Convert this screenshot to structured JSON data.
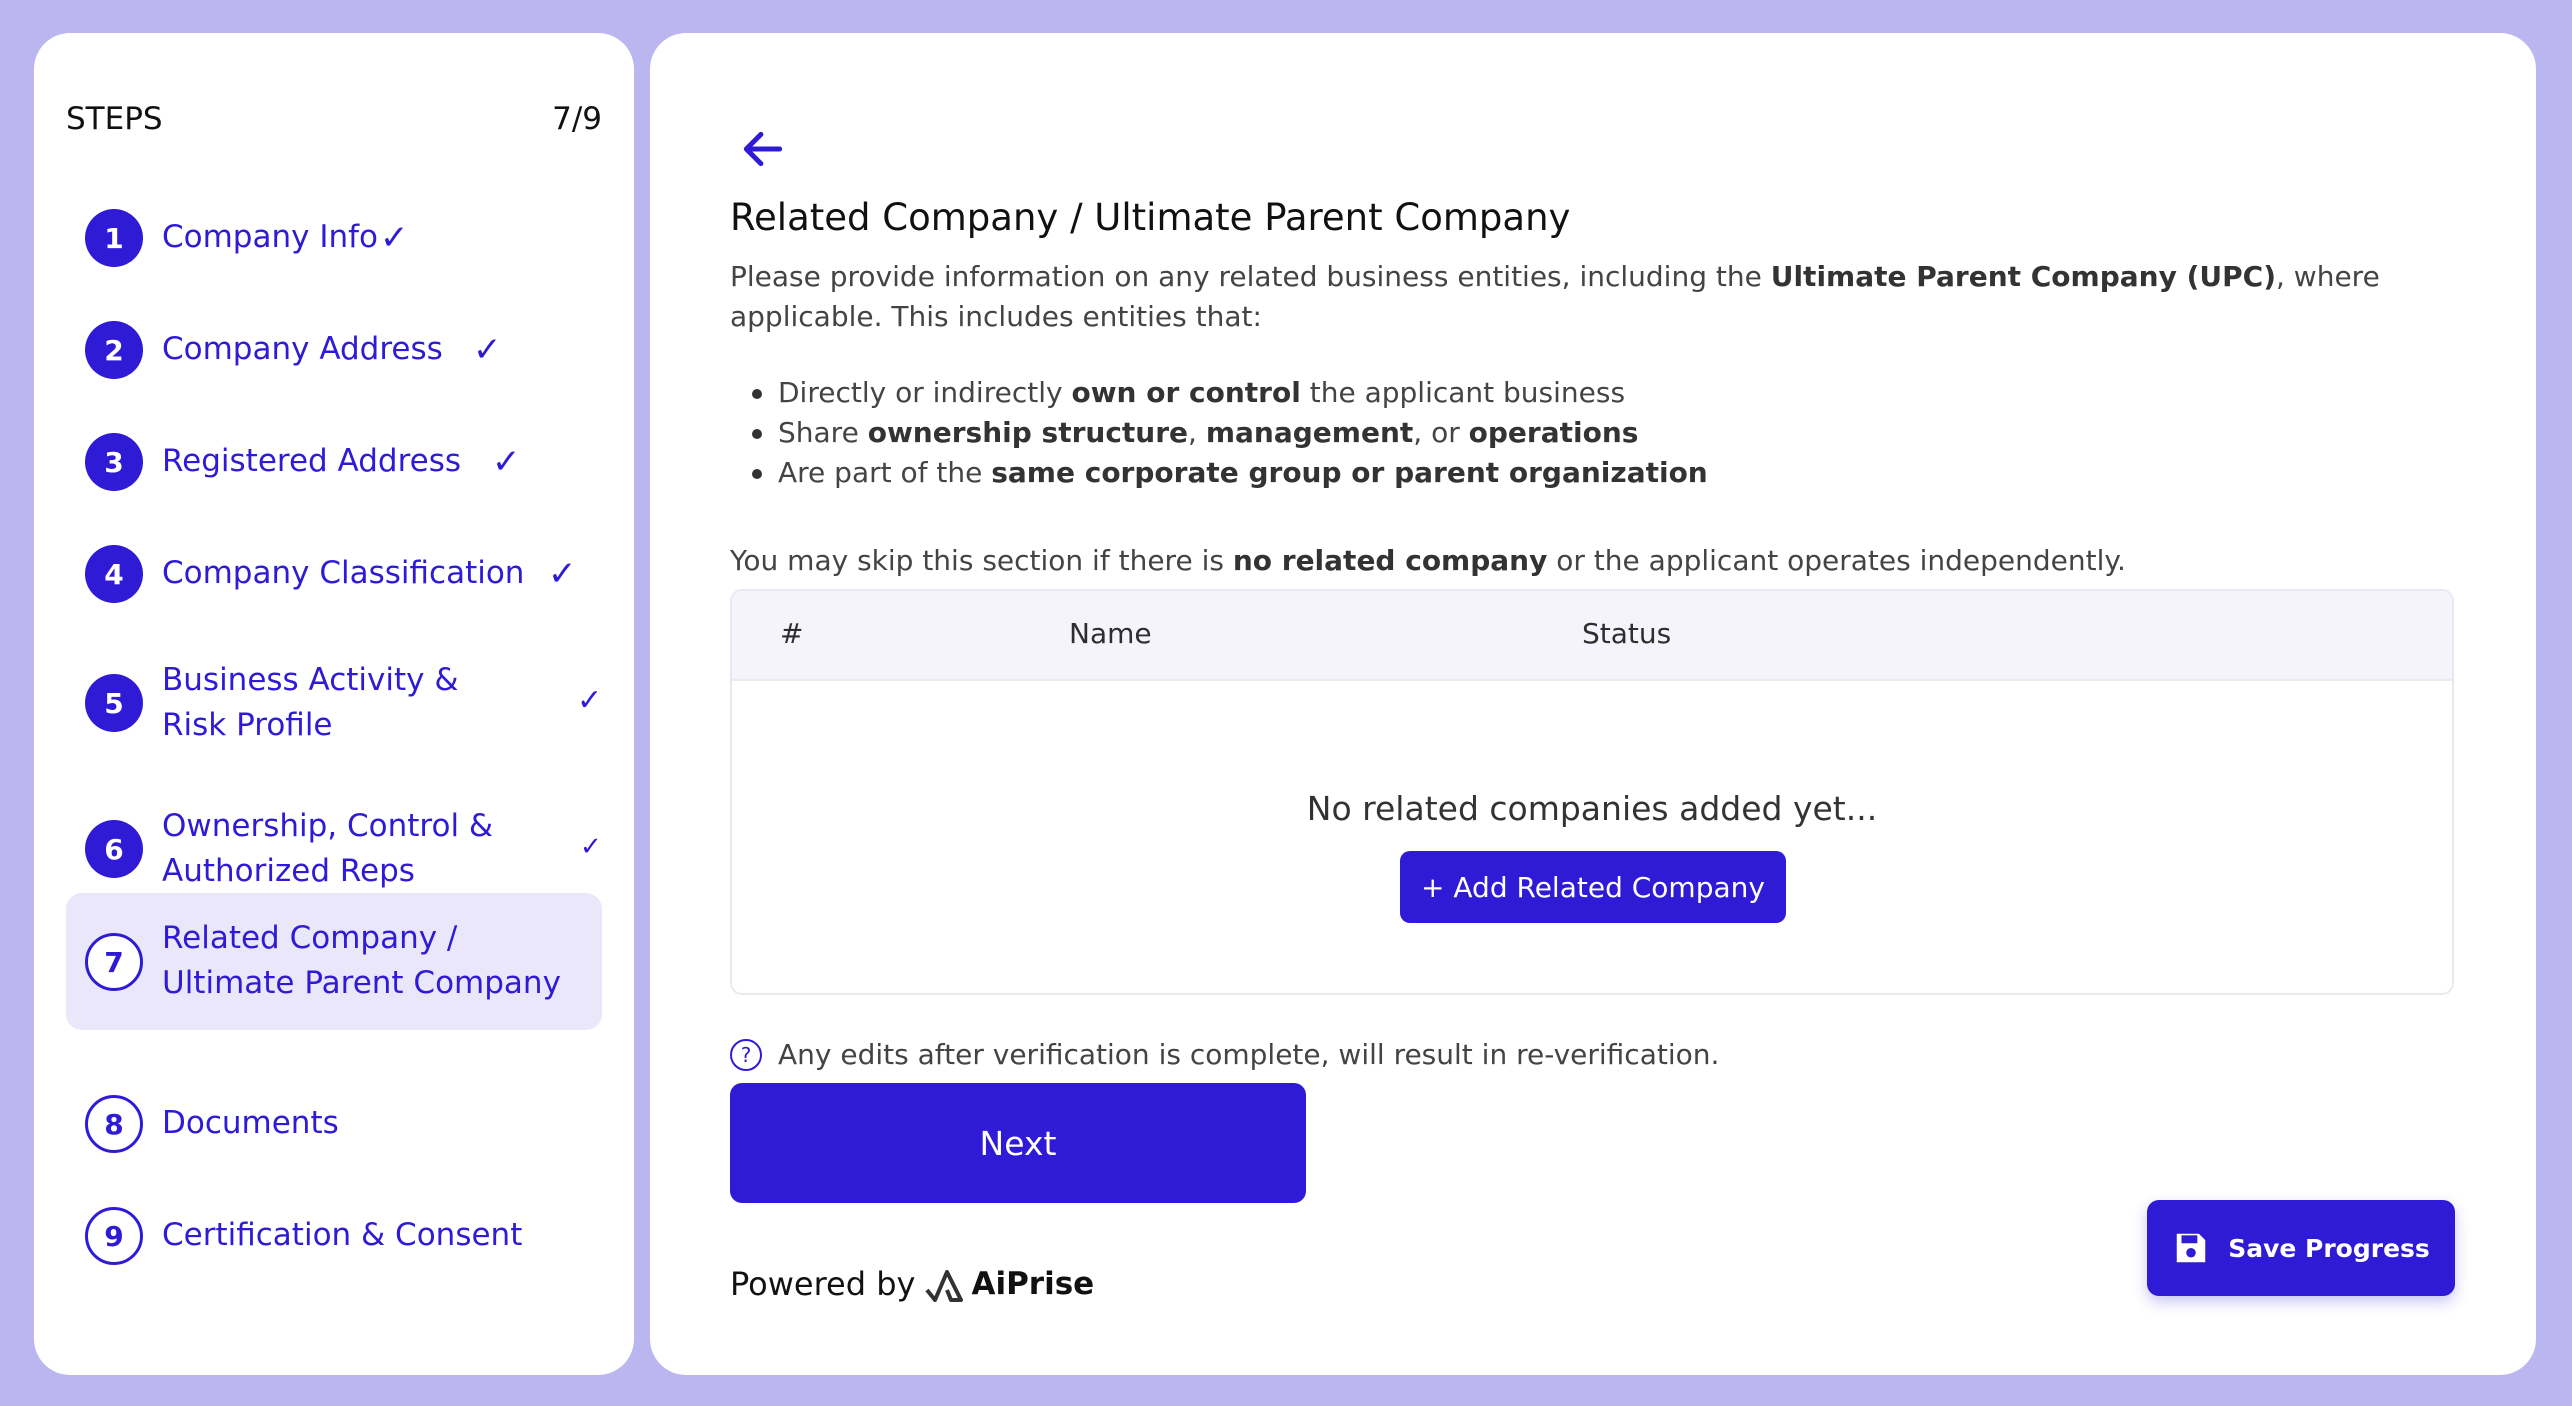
{
  "colors": {
    "accent": "#2f1bd6",
    "background": "#bbb5f0",
    "active_step_bg": "#eae7fb"
  },
  "sidebar": {
    "title": "STEPS",
    "progress": "7/9",
    "steps": [
      {
        "number": "1",
        "label": "Company Info",
        "status": "complete"
      },
      {
        "number": "2",
        "label": "Company Address",
        "status": "complete"
      },
      {
        "number": "3",
        "label": "Registered Address",
        "status": "complete"
      },
      {
        "number": "4",
        "label": "Company Classification",
        "status": "complete"
      },
      {
        "number": "5",
        "label": "Business Activity & Risk Profile",
        "status": "complete"
      },
      {
        "number": "6",
        "label": "Ownership, Control & Authorized Reps",
        "status": "complete"
      },
      {
        "number": "7",
        "label": "Related Company / Ultimate Parent Company",
        "status": "current"
      },
      {
        "number": "8",
        "label": "Documents",
        "status": "pending"
      },
      {
        "number": "9",
        "label": "Certification & Consent",
        "status": "pending"
      }
    ]
  },
  "main": {
    "back_icon": "arrow-left-icon",
    "title": "Related Company / Ultimate Parent Company",
    "intro": {
      "part1": "Please provide information on any related business entities, including the ",
      "bold1": "Ultimate Parent Company (UPC)",
      "part2": ", where applicable. This includes entities that:"
    },
    "bullets": [
      {
        "pre": "Directly or indirectly ",
        "bold": "own or control",
        "post": " the applicant business"
      },
      {
        "pre": "Share ",
        "bold": "ownership structure",
        "mid": ", ",
        "bold2": "management",
        "mid2": ", or ",
        "bold3": "operations"
      },
      {
        "pre": "Are part of the ",
        "bold": "same corporate group or parent organization"
      }
    ],
    "skip_note": {
      "pre": "You may skip this section if there is ",
      "bold": "no related company",
      "post": " or the applicant operates independently."
    },
    "table": {
      "columns": [
        "#",
        "Name",
        "Status"
      ],
      "empty_text": "No related companies added yet...",
      "add_button": "+ Add Related Company"
    },
    "notice": "Any edits after verification is complete, will result in re-verification.",
    "next_button": "Next",
    "powered_by": "Powered by",
    "brand": "AiPrise",
    "save_button": "Save Progress",
    "save_icon": "floppy-disk-icon"
  }
}
